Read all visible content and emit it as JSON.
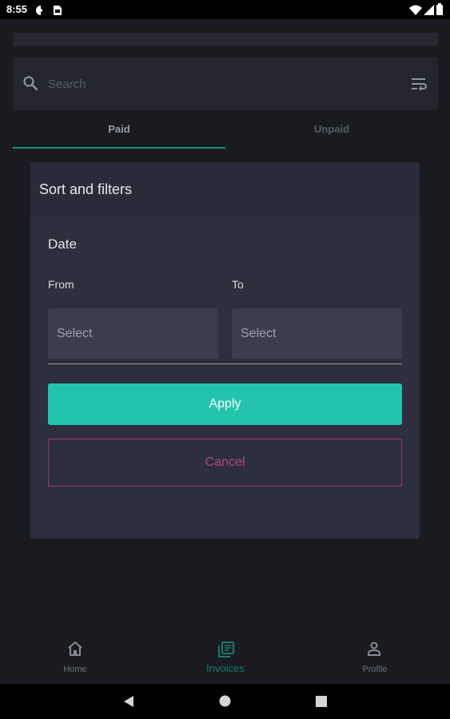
{
  "status_bar": {
    "time": "8:55"
  },
  "search": {
    "placeholder": "Search"
  },
  "tabs": [
    {
      "label": "Paid",
      "active": true
    },
    {
      "label": "Unpaid",
      "active": false
    }
  ],
  "dialog": {
    "title": "Sort and filters",
    "date_label": "Date",
    "from_label": "From",
    "to_label": "To",
    "from_value": "Select",
    "to_value": "Select",
    "apply_label": "Apply",
    "cancel_label": "Cancel"
  },
  "bottom_nav": [
    {
      "label": "Home",
      "icon": "home-icon",
      "active": false
    },
    {
      "label": "Invoices",
      "icon": "invoices-icon",
      "active": true
    },
    {
      "label": "Profile",
      "icon": "profile-icon",
      "active": false
    }
  ],
  "colors": {
    "accent": "#24c4ac",
    "cancel": "#b7477c",
    "background": "#1a1b21",
    "dialog": "#2d2e3e"
  }
}
